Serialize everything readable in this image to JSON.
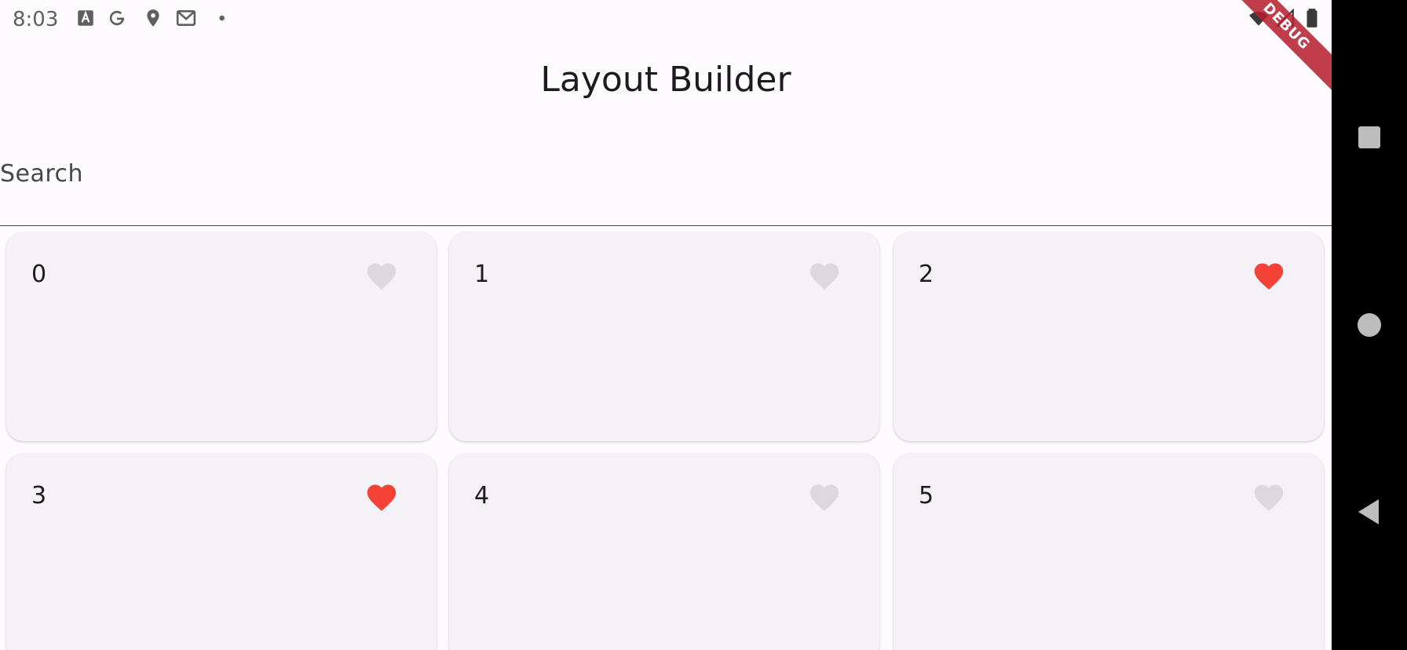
{
  "status_bar": {
    "time": "8:03",
    "left_icons": [
      "text-a-icon",
      "google-g-icon",
      "location-pin-icon",
      "gmail-icon",
      "dot-icon"
    ],
    "right_icons": [
      "wifi-icon",
      "cell-signal-icon",
      "battery-icon"
    ]
  },
  "debug_banner": "DEBUG",
  "app_bar": {
    "title": "Layout Builder"
  },
  "search": {
    "label": "Search"
  },
  "cards": [
    {
      "label": "0",
      "favorite": false
    },
    {
      "label": "1",
      "favorite": false
    },
    {
      "label": "2",
      "favorite": true
    },
    {
      "label": "3",
      "favorite": true
    },
    {
      "label": "4",
      "favorite": false
    },
    {
      "label": "5",
      "favorite": false
    }
  ],
  "nav_bar": {
    "buttons": [
      "recents-square-icon",
      "home-circle-icon",
      "back-triangle-icon"
    ]
  },
  "colors": {
    "heart_on": "#f44336",
    "heart_off": "#dcd8dc",
    "card_bg": "#f4f1f7",
    "background": "#fefbfe",
    "banner": "#b71c2c"
  }
}
